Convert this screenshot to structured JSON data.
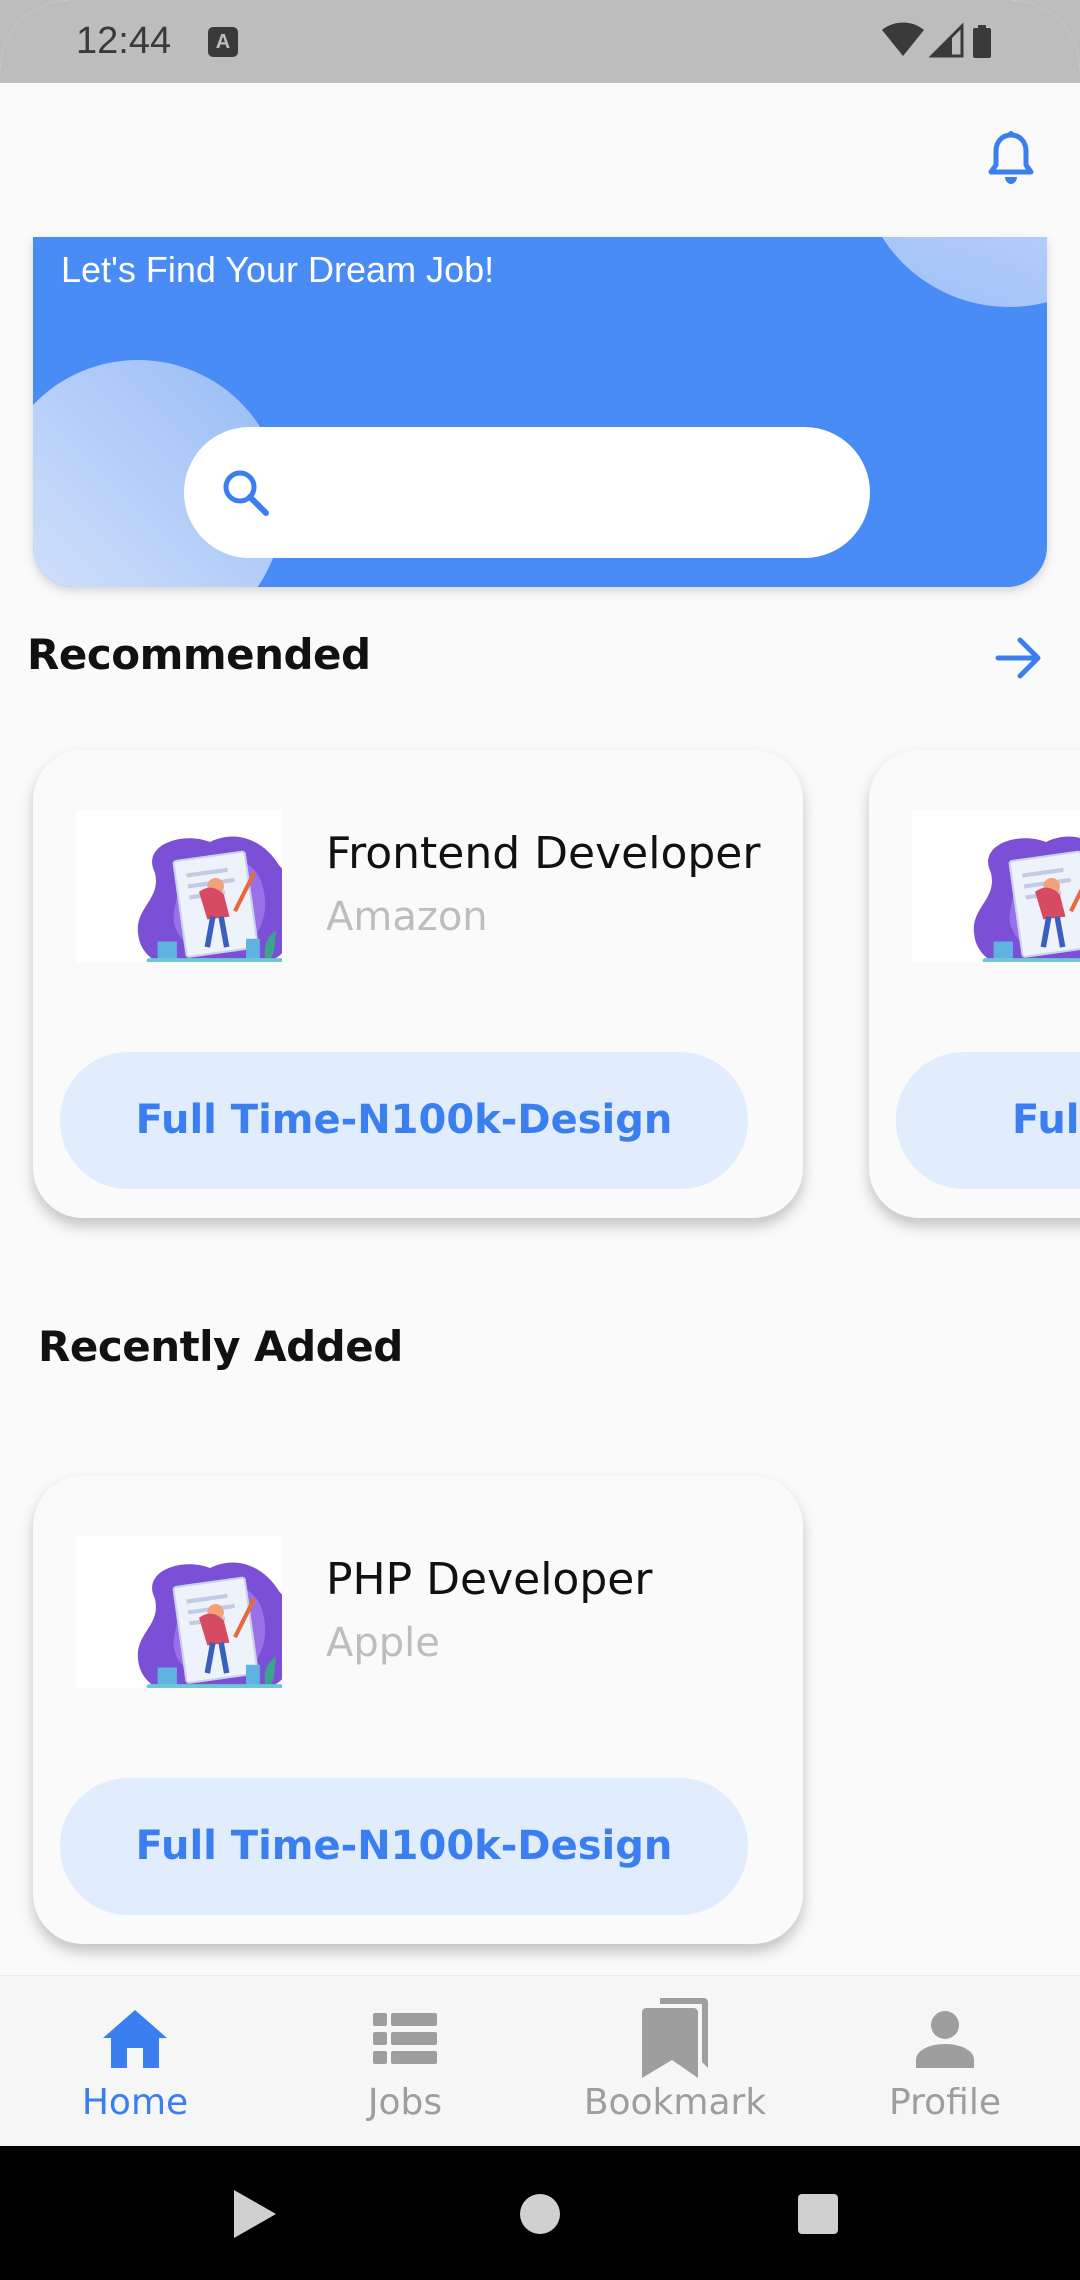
{
  "status_bar": {
    "time": "12:44",
    "notif_badge": "A"
  },
  "app_bar": {
    "notification_icon": "bell-icon"
  },
  "hero": {
    "title": "Let's Find Your Dream Job!",
    "search_placeholder": ""
  },
  "recommended": {
    "title": "Recommended",
    "cards": [
      {
        "title": "Frontend Developer",
        "company": "Amazon",
        "tag": "Full Time-N100k-Design"
      },
      {
        "title": "",
        "company": "",
        "tag": "Full"
      }
    ]
  },
  "recent": {
    "title": "Recently Added",
    "cards": [
      {
        "title": "PHP Developer",
        "company": "Apple",
        "tag": "Full Time-N100k-Design"
      }
    ]
  },
  "bottom_nav": {
    "items": [
      {
        "label": "Home",
        "icon": "home-icon",
        "active": true
      },
      {
        "label": "Jobs",
        "icon": "list-icon",
        "active": false
      },
      {
        "label": "Bookmark",
        "icon": "bookmark-icon",
        "active": false
      },
      {
        "label": "Profile",
        "icon": "person-icon",
        "active": false
      }
    ]
  },
  "colors": {
    "primary": "#4a8cf5",
    "accent": "#3b7ef0",
    "tag_bg": "#e1edfd"
  }
}
